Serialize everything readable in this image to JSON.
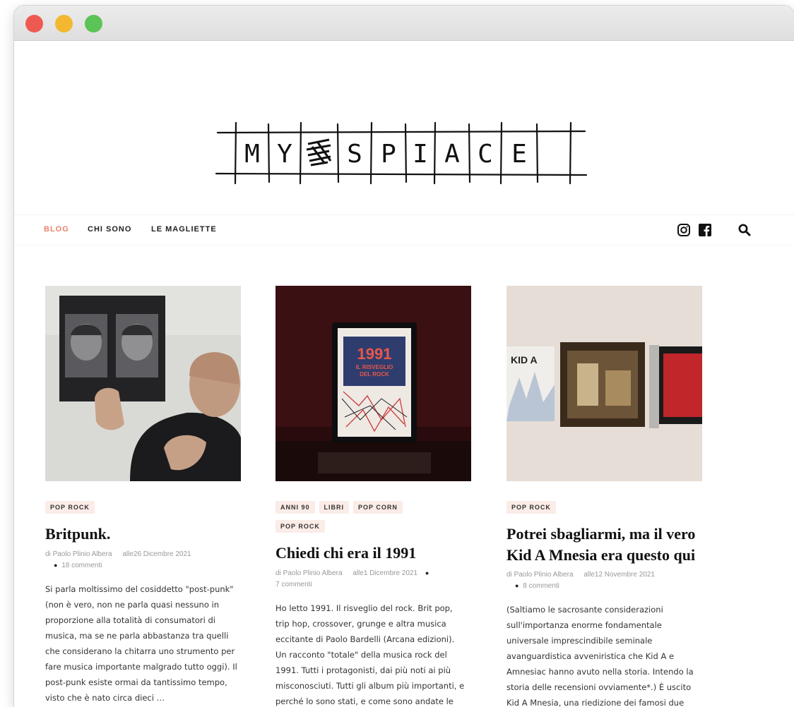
{
  "logo": {
    "text": "MY SPIACE",
    "letters": [
      "M",
      "Y",
      "",
      "S",
      "P",
      "I",
      "A",
      "C",
      "E"
    ]
  },
  "nav": {
    "items": [
      {
        "label": "BLOG",
        "active": true
      },
      {
        "label": "CHI SONO",
        "active": false
      },
      {
        "label": "LE MAGLIETTE",
        "active": false
      }
    ],
    "icons": [
      "instagram-icon",
      "facebook-icon",
      "search-icon"
    ],
    "accent_color": "#e9826e"
  },
  "posts": [
    {
      "categories": [
        "POP ROCK"
      ],
      "title": "Britpunk.",
      "author_prefix": "di",
      "author": "Paolo Plinio Albera",
      "date_prefix": "alle",
      "date": "26 Dicembre 2021",
      "comments": "18 commenti",
      "excerpt": "Si parla moltissimo del cosiddetto \"post-punk\" (non è vero, non ne parla quasi nessuno in proporzione alla totalità di consumatori di musica, ma se ne parla abbastanza tra quelli che considerano la chitarra uno strumento per fare musica importante malgrado tutto oggi). Il post-punk esiste ormai da tantissimo tempo, visto che è nato circa dieci …"
    },
    {
      "categories": [
        "ANNI 90",
        "LIBRI",
        "POP CORN",
        "POP ROCK"
      ],
      "title": "Chiedi chi era il 1991",
      "author_prefix": "di",
      "author": "Paolo Plinio Albera",
      "date_prefix": "alle",
      "date": "1 Dicembre 2021",
      "comments": "7 commenti",
      "excerpt": "Ho letto 1991. Il risveglio del rock. Brit pop, trip hop, crossover, grunge e altra musica eccitante di Paolo Bardelli (Arcana edizioni). Un racconto \"totale\" della musica rock del 1991. Tutti i protagonisti, dai più noti ai più misconosciuti. Tutti gli album più importanti, e perché lo sono stati, e come sono andate le"
    },
    {
      "categories": [
        "POP ROCK"
      ],
      "title": "Potrei sbagliarmi, ma il vero Kid A Mnesia era questo qui",
      "author_prefix": "di",
      "author": "Paolo Plinio Albera",
      "date_prefix": "alle",
      "date": "12 Novembre 2021",
      "comments": "8 commenti",
      "excerpt": "(Saltiamo le sacrosante considerazioni sull'importanza enorme fondamentale universale imprescindibile seminale avanguardistica avveniristica che Kid A e Amnesiac hanno avuto nella storia. Intendo la storia delle recensioni ovviamente*.) È uscito Kid A Mnesia, una riedizione dei famosi due"
    }
  ],
  "images": {
    "post1_album_text": "",
    "post2_book_line1": "1991",
    "post2_book_line2": "IL RISVEGLIO",
    "post2_book_line3": "DEL ROCK",
    "post3_album_text": "KID A"
  }
}
